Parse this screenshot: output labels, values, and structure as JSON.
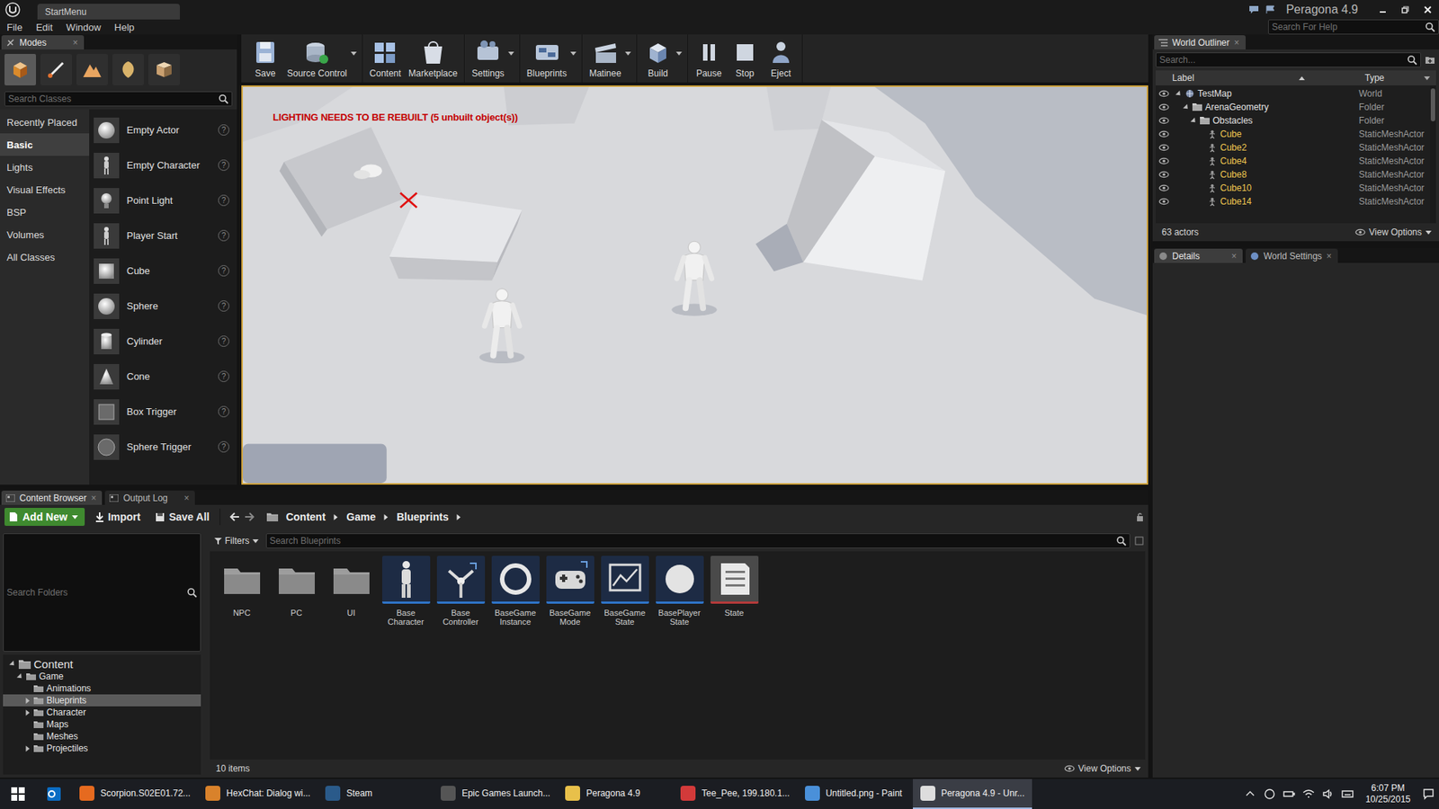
{
  "window": {
    "document_tab": "StartMenu",
    "project": "Peragona 4.9",
    "help_search": {
      "placeholder": "Search For Help"
    }
  },
  "menu": [
    "File",
    "Edit",
    "Window",
    "Help"
  ],
  "close_glyph": "×",
  "modes": {
    "tab": "Modes",
    "mode_buttons": [
      {
        "selected": true
      },
      {
        "selected": false
      },
      {
        "selected": false
      },
      {
        "selected": false
      },
      {
        "selected": false
      }
    ],
    "search": {
      "placeholder": "Search Classes"
    },
    "categories": [
      {
        "label": "Recently Placed",
        "selected": false
      },
      {
        "label": "Basic",
        "selected": true
      },
      {
        "label": "Lights",
        "selected": false
      },
      {
        "label": "Visual Effects",
        "selected": false
      },
      {
        "label": "BSP",
        "selected": false
      },
      {
        "label": "Volumes",
        "selected": false
      },
      {
        "label": "All Classes",
        "selected": false
      }
    ],
    "items": [
      "Empty Actor",
      "Empty Character",
      "Point Light",
      "Player Start",
      "Cube",
      "Sphere",
      "Cylinder",
      "Cone",
      "Box Trigger",
      "Sphere Trigger"
    ],
    "help_glyph": "?"
  },
  "toolbar": [
    {
      "label": "Save",
      "dropdown": false
    },
    {
      "label": "Source Control",
      "dropdown": true
    },
    {
      "label": "Content",
      "dropdown": false
    },
    {
      "label": "Marketplace",
      "dropdown": false
    },
    {
      "label": "Settings",
      "dropdown": true
    },
    {
      "label": "Blueprints",
      "dropdown": true
    },
    {
      "label": "Matinee",
      "dropdown": true
    },
    {
      "label": "Build",
      "dropdown": true
    },
    {
      "label": "Pause",
      "dropdown": false
    },
    {
      "label": "Stop",
      "dropdown": false
    },
    {
      "label": "Eject",
      "dropdown": false
    }
  ],
  "viewport": {
    "warning": "LIGHTING NEEDS TO BE REBUILT (5 unbuilt object(s))"
  },
  "outliner": {
    "tab": "World Outliner",
    "search": {
      "placeholder": "Search..."
    },
    "columns": [
      "Label",
      "Type"
    ],
    "rows": [
      {
        "label": "TestMap",
        "type": "World",
        "depth": 0,
        "kind": "world",
        "expanded": true,
        "highlighted": false
      },
      {
        "label": "ArenaGeometry",
        "type": "Folder",
        "depth": 1,
        "kind": "folder",
        "expanded": true,
        "highlighted": false
      },
      {
        "label": "Obstacles",
        "type": "Folder",
        "depth": 2,
        "kind": "folder",
        "expanded": true,
        "highlighted": false
      },
      {
        "label": "Cube",
        "type": "StaticMeshActor",
        "depth": 3,
        "kind": "actor",
        "expanded": false,
        "highlighted": true
      },
      {
        "label": "Cube2",
        "type": "StaticMeshActor",
        "depth": 3,
        "kind": "actor",
        "expanded": false,
        "highlighted": true
      },
      {
        "label": "Cube4",
        "type": "StaticMeshActor",
        "depth": 3,
        "kind": "actor",
        "expanded": false,
        "highlighted": true
      },
      {
        "label": "Cube8",
        "type": "StaticMeshActor",
        "depth": 3,
        "kind": "actor",
        "expanded": false,
        "highlighted": true
      },
      {
        "label": "Cube10",
        "type": "StaticMeshActor",
        "depth": 3,
        "kind": "actor",
        "expanded": false,
        "highlighted": true
      },
      {
        "label": "Cube14",
        "type": "StaticMeshActor",
        "depth": 3,
        "kind": "actor",
        "expanded": false,
        "highlighted": true
      }
    ],
    "count": "63 actors",
    "view_options": "View Options"
  },
  "details": {
    "tabs": [
      {
        "label": "Details",
        "selected": true
      },
      {
        "label": "World Settings",
        "selected": false
      }
    ]
  },
  "content_browser": {
    "tabs": [
      {
        "label": "Content Browser",
        "selected": true
      },
      {
        "label": "Output Log",
        "selected": false
      }
    ],
    "buttons": [
      "Add New",
      "Import",
      "Save All"
    ],
    "path": [
      "Content",
      "Game",
      "Blueprints"
    ],
    "folder_search": {
      "placeholder": "Search Folders"
    },
    "tree": [
      {
        "label": "Content",
        "depth": 0,
        "expanded": true,
        "has_children": true,
        "selected": false
      },
      {
        "label": "Game",
        "depth": 1,
        "expanded": true,
        "has_children": true,
        "selected": false
      },
      {
        "label": "Animations",
        "depth": 2,
        "expanded": false,
        "has_children": false,
        "selected": false
      },
      {
        "label": "Blueprints",
        "depth": 2,
        "expanded": false,
        "has_children": true,
        "selected": true
      },
      {
        "label": "Character",
        "depth": 2,
        "expanded": false,
        "has_children": true,
        "selected": false
      },
      {
        "label": "Maps",
        "depth": 2,
        "expanded": false,
        "has_children": false,
        "selected": false
      },
      {
        "label": "Meshes",
        "depth": 2,
        "expanded": false,
        "has_children": false,
        "selected": false
      },
      {
        "label": "Projectiles",
        "depth": 2,
        "expanded": false,
        "has_children": true,
        "selected": false
      }
    ],
    "filters": "Filters",
    "asset_search": {
      "placeholder": "Search Blueprints"
    },
    "assets": [
      {
        "label": "NPC",
        "kind": "folder"
      },
      {
        "label": "PC",
        "kind": "folder"
      },
      {
        "label": "UI",
        "kind": "folder"
      },
      {
        "label": "Base Character",
        "kind": "character",
        "color": "#2f74c8"
      },
      {
        "label": "Base Controller",
        "kind": "controller",
        "color": "#2f74c8"
      },
      {
        "label": "BaseGame Instance",
        "kind": "instance",
        "color": "#2f74c8"
      },
      {
        "label": "BaseGame Mode",
        "kind": "mode",
        "color": "#2f74c8"
      },
      {
        "label": "BaseGame State",
        "kind": "gamestate",
        "color": "#2f74c8"
      },
      {
        "label": "BasePlayer State",
        "kind": "playerstate",
        "color": "#2f74c8"
      },
      {
        "label": "State",
        "kind": "enum",
        "color": "#b53a3a"
      }
    ],
    "count": "10 items",
    "view_options": "View Options"
  },
  "taskbar": {
    "items": [
      {
        "label": "Scorpion.S02E01.72...",
        "color": "#e66a1f",
        "selected": false
      },
      {
        "label": "HexChat: Dialog wi...",
        "color": "#d9822b",
        "selected": false
      },
      {
        "label": "Steam",
        "color": "#2a5a8a",
        "selected": false
      },
      {
        "label": "Epic Games Launch...",
        "color": "#555555",
        "selected": false
      },
      {
        "label": "Peragona 4.9",
        "color": "#e8c04a",
        "selected": false
      },
      {
        "label": "Tee_Pee, 199.180.1...",
        "color": "#d33a3a",
        "selected": false
      },
      {
        "label": "Untitled.png - Paint",
        "color": "#4a90d9",
        "selected": false
      },
      {
        "label": "Peragona 4.9 - Unr...",
        "color": "#dddddd",
        "selected": true
      }
    ],
    "time": "6:07 PM",
    "date": "10/25/2015"
  }
}
